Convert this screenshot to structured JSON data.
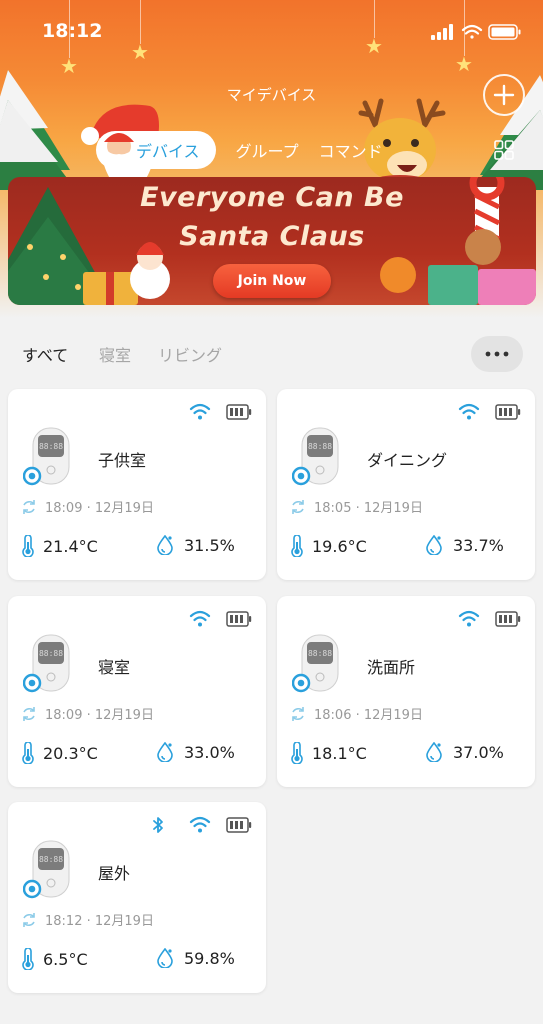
{
  "status": {
    "time": "18:12"
  },
  "header": {
    "title": "マイデバイス"
  },
  "tabs": [
    {
      "label": "デバイス",
      "active": true
    },
    {
      "label": "グループ",
      "active": false
    },
    {
      "label": "コマンド",
      "active": false
    }
  ],
  "banner": {
    "line1": "Everyone Can Be",
    "line2": "Santa Claus",
    "button": "Join Now"
  },
  "filters": [
    {
      "label": "すべて",
      "active": true
    },
    {
      "label": "寝室",
      "active": false
    },
    {
      "label": "リビング",
      "active": false
    }
  ],
  "devices": [
    {
      "name": "子供室",
      "sync": "18:09 · 12月19日",
      "temperature": "21.4°C",
      "humidity": "31.5%",
      "bluetooth": false
    },
    {
      "name": "ダイニング",
      "sync": "18:05 · 12月19日",
      "temperature": "19.6°C",
      "humidity": "33.7%",
      "bluetooth": false
    },
    {
      "name": "寝室",
      "sync": "18:09 · 12月19日",
      "temperature": "20.3°C",
      "humidity": "33.0%",
      "bluetooth": false
    },
    {
      "name": "洗面所",
      "sync": "18:06 · 12月19日",
      "temperature": "18.1°C",
      "humidity": "37.0%",
      "bluetooth": false
    },
    {
      "name": "屋外",
      "sync": "18:12 · 12月19日",
      "temperature": "6.5°C",
      "humidity": "59.8%",
      "bluetooth": true
    }
  ],
  "colors": {
    "accent": "#2aa0dc",
    "header_top": "#f2732b",
    "banner": "#b2301f",
    "join_button": "#e43a24",
    "background": "#f2f2f2"
  },
  "icons": [
    "signal-icon",
    "wifi-icon",
    "battery-icon",
    "plus-icon",
    "grid-icon",
    "more-icon",
    "bluetooth-icon",
    "sync-icon",
    "thermometer-icon",
    "humidity-icon"
  ]
}
